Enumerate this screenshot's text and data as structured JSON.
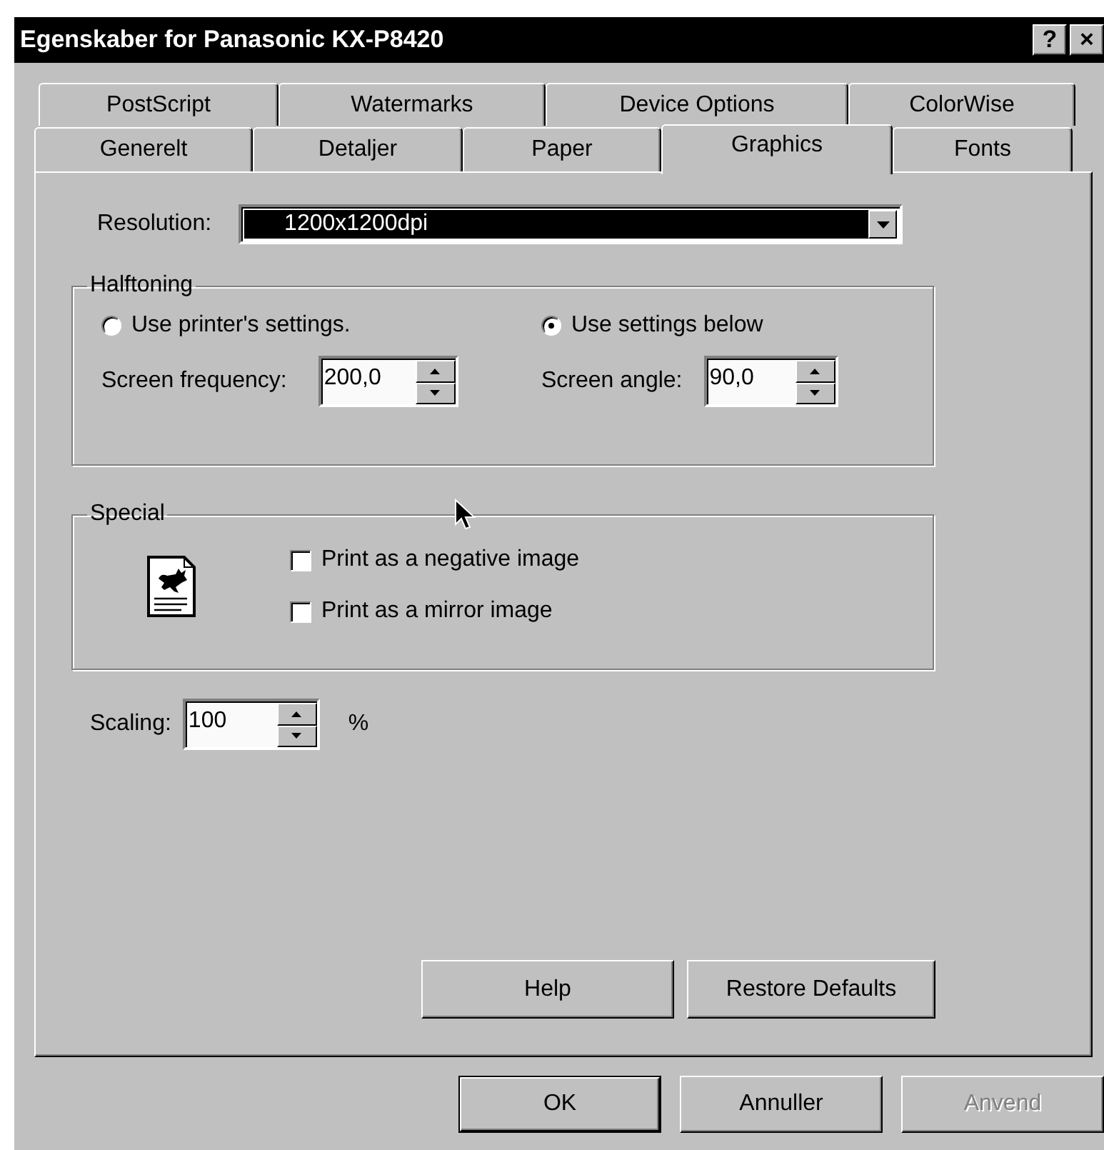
{
  "window": {
    "title": "Egenskaber for Panasonic KX-P8420",
    "title_buttons": [
      "?",
      "×"
    ]
  },
  "tabs": [
    [
      {
        "label": "PostScript",
        "selected": false
      },
      {
        "label": "Watermarks",
        "selected": false
      },
      {
        "label": "Device Options",
        "selected": false
      },
      {
        "label": "ColorWise",
        "selected": false
      }
    ],
    [
      {
        "label": "Generelt",
        "selected": false
      },
      {
        "label": "Detaljer",
        "selected": false
      },
      {
        "label": "Paper",
        "selected": false
      },
      {
        "label": "Graphics",
        "selected": true
      },
      {
        "label": "Fonts",
        "selected": false
      }
    ]
  ],
  "resolution": {
    "label": "Resolution:",
    "value": "1200x1200dpi"
  },
  "halftoning": {
    "title": "Halftoning",
    "options": [
      {
        "label": "Use printer's settings.",
        "selected": false
      },
      {
        "label": "Use settings below",
        "selected": true
      }
    ],
    "fields": [
      {
        "label": "Screen frequency:",
        "value": "200,0"
      },
      {
        "label": "Screen angle:",
        "value": "90,0"
      }
    ]
  },
  "special": {
    "title": "Special",
    "checkboxes": [
      {
        "label": "Print as a negative image",
        "checked": false
      },
      {
        "label": "Print as a mirror image",
        "checked": false
      }
    ]
  },
  "scaling": {
    "label": "Scaling:",
    "value": "100",
    "unit": "%"
  },
  "panel_buttons": [
    {
      "label": "Help"
    },
    {
      "label": "Restore Defaults"
    }
  ],
  "dialog_buttons": [
    {
      "label": "OK",
      "default": true,
      "disabled": false
    },
    {
      "label": "Annuller",
      "default": false,
      "disabled": false
    },
    {
      "label": "Anvend",
      "default": false,
      "disabled": true
    }
  ]
}
